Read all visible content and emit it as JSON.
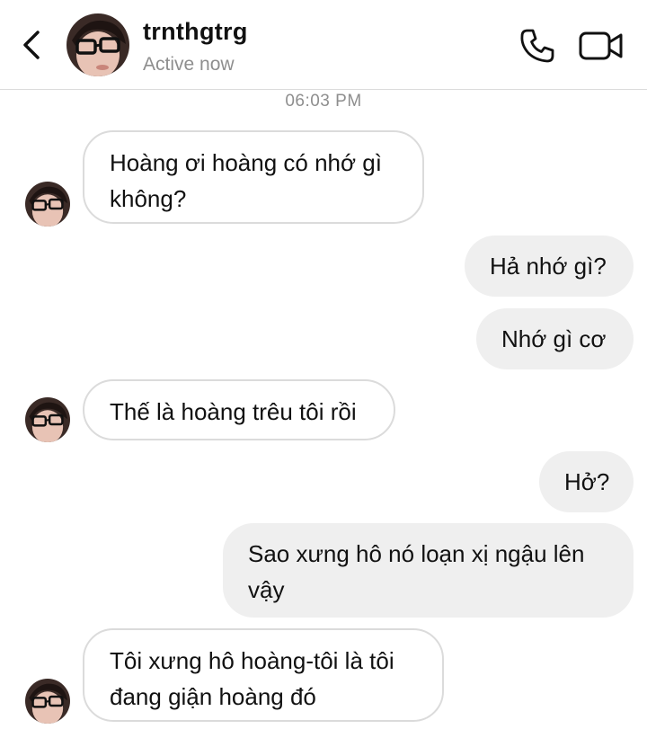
{
  "header": {
    "username": "trnthgtrg",
    "status": "Active now"
  },
  "timestamp": "06:03 PM",
  "messages": [
    {
      "from": "them",
      "text": "Hoàng ơi hoàng có nhớ gì không?"
    },
    {
      "from": "me",
      "text": "Hả nhớ gì?"
    },
    {
      "from": "me",
      "text": "Nhớ gì cơ"
    },
    {
      "from": "them",
      "text": "Thế là hoàng trêu tôi rồi"
    },
    {
      "from": "me",
      "text": "Hở?"
    },
    {
      "from": "me",
      "text": "Sao xưng hô nó loạn xị ngậu lên vậy"
    },
    {
      "from": "them",
      "text": "Tôi xưng hô hoàng-tôi là tôi đang giận hoàng đó"
    }
  ],
  "icons": {
    "back": "chevron-left-icon",
    "call": "phone-icon",
    "video": "video-camera-icon"
  }
}
